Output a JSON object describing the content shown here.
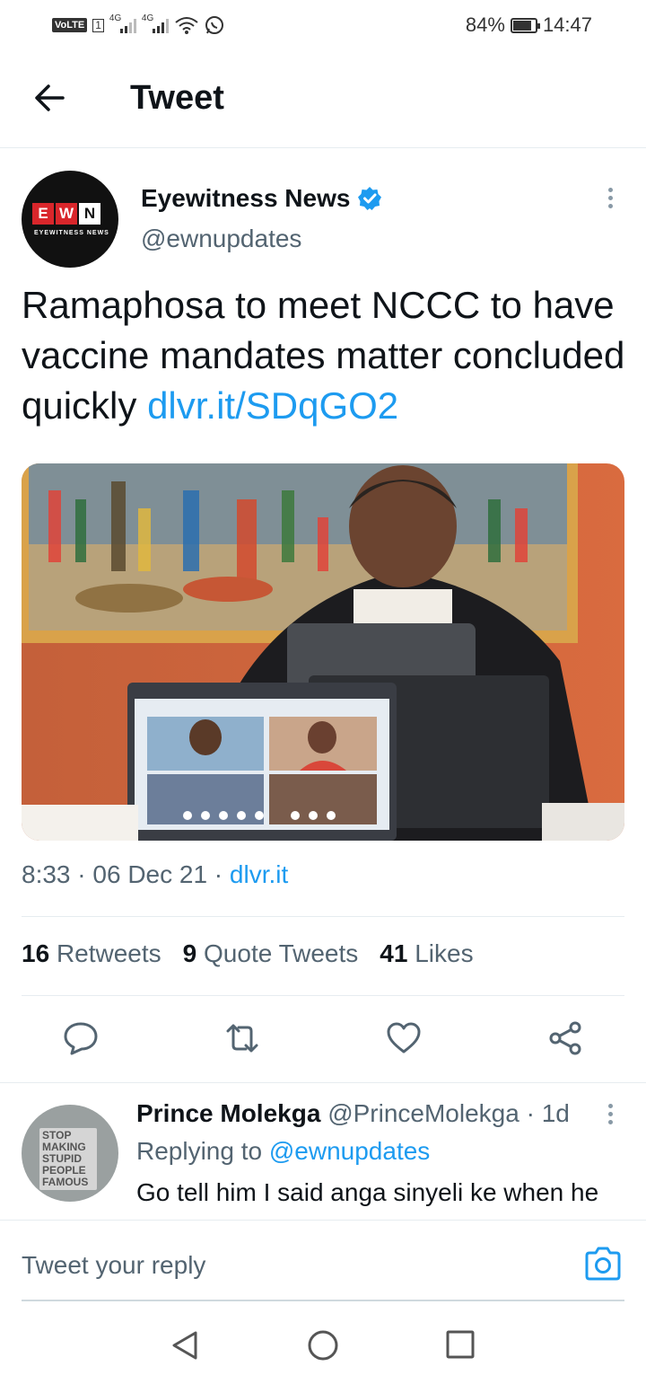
{
  "status_bar": {
    "volte": "VoLTE",
    "sim": "1",
    "net1": "4G",
    "net2": "4G",
    "battery": "84%",
    "battery_level": 0.84,
    "time": "14:47"
  },
  "header": {
    "title": "Tweet",
    "back_icon": "arrow-left-icon"
  },
  "tweet": {
    "author_name": "Eyewitness News",
    "author_handle": "@ewnupdates",
    "avatar_logo": {
      "e": "E",
      "w": "W",
      "n": "N",
      "tagline": "EYEWITNESS NEWS"
    },
    "text": "Ramaphosa to meet NCCC to have vaccine mandates matter concluded quickly ",
    "link": "dlvr.it/SDqGO2",
    "time": "8:33",
    "date": "06 Dec 21",
    "source": "dlvr.it",
    "separator": " · ",
    "stats": {
      "retweets_count": "16",
      "retweets_label": "Retweets",
      "quotes_count": "9",
      "quotes_label": "Quote Tweets",
      "likes_count": "41",
      "likes_label": "Likes"
    },
    "actions": [
      "reply-icon",
      "retweet-icon",
      "like-icon",
      "share-icon"
    ]
  },
  "reply": {
    "name": "Prince Molekga",
    "handle": "@PrinceMolekga",
    "age": "· 1d",
    "replying_to_label": "Replying to",
    "replying_to_handle": "@ewnupdates",
    "text": "Go tell him I said anga sinyeli ke when he",
    "avatar_sign": "STOP MAKING STUPID PEOPLE FAMOUS"
  },
  "reply_bar": {
    "placeholder": "Tweet your reply"
  },
  "colors": {
    "accent": "#1d9bf0",
    "text": "#0f1419",
    "secondary": "#536471"
  }
}
